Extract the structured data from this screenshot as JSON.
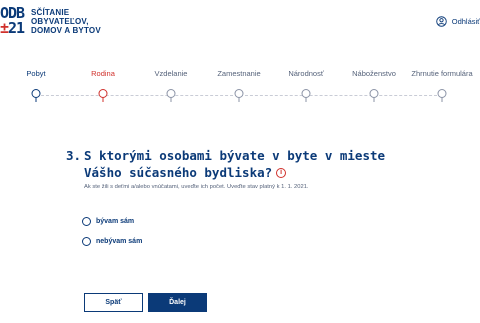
{
  "header": {
    "logo_top": "ODB",
    "logo_bottom_red": "±",
    "logo_bottom": "21",
    "brand_line1": "SČÍTANIE",
    "brand_line2": "OBYVATEĽOV,",
    "brand_line3": "DOMOV A BYTOV",
    "logout_label": "Odhlásiť",
    "logout_icon": "user-circle-icon"
  },
  "stepper": {
    "steps": [
      {
        "label": "Pobyt",
        "state": "done"
      },
      {
        "label": "Rodina",
        "state": "active"
      },
      {
        "label": "Vzdelanie",
        "state": "pending"
      },
      {
        "label": "Zamestnanie",
        "state": "pending"
      },
      {
        "label": "Národnosť",
        "state": "pending"
      },
      {
        "label": "Náboženstvo",
        "state": "pending"
      },
      {
        "label": "Zhrnutie formulára",
        "state": "pending"
      }
    ]
  },
  "question": {
    "number": "3.",
    "line1": "S ktorými osobami bývate v byte v mieste",
    "line2": "Vášho súčasného bydliska?",
    "info_icon_text": "i",
    "hint": "Ak ste žili s deťmi a/alebo vnúčatami, uveďte ich počet. Uveďte stav platný k 1. 1. 2021."
  },
  "options": [
    {
      "label": "bývam sám"
    },
    {
      "label": "nebývam sám"
    }
  ],
  "buttons": {
    "back": "Späť",
    "next": "Ďalej"
  },
  "colors": {
    "primary": "#0b3a78",
    "accent": "#d0302b",
    "muted": "#55627a"
  }
}
